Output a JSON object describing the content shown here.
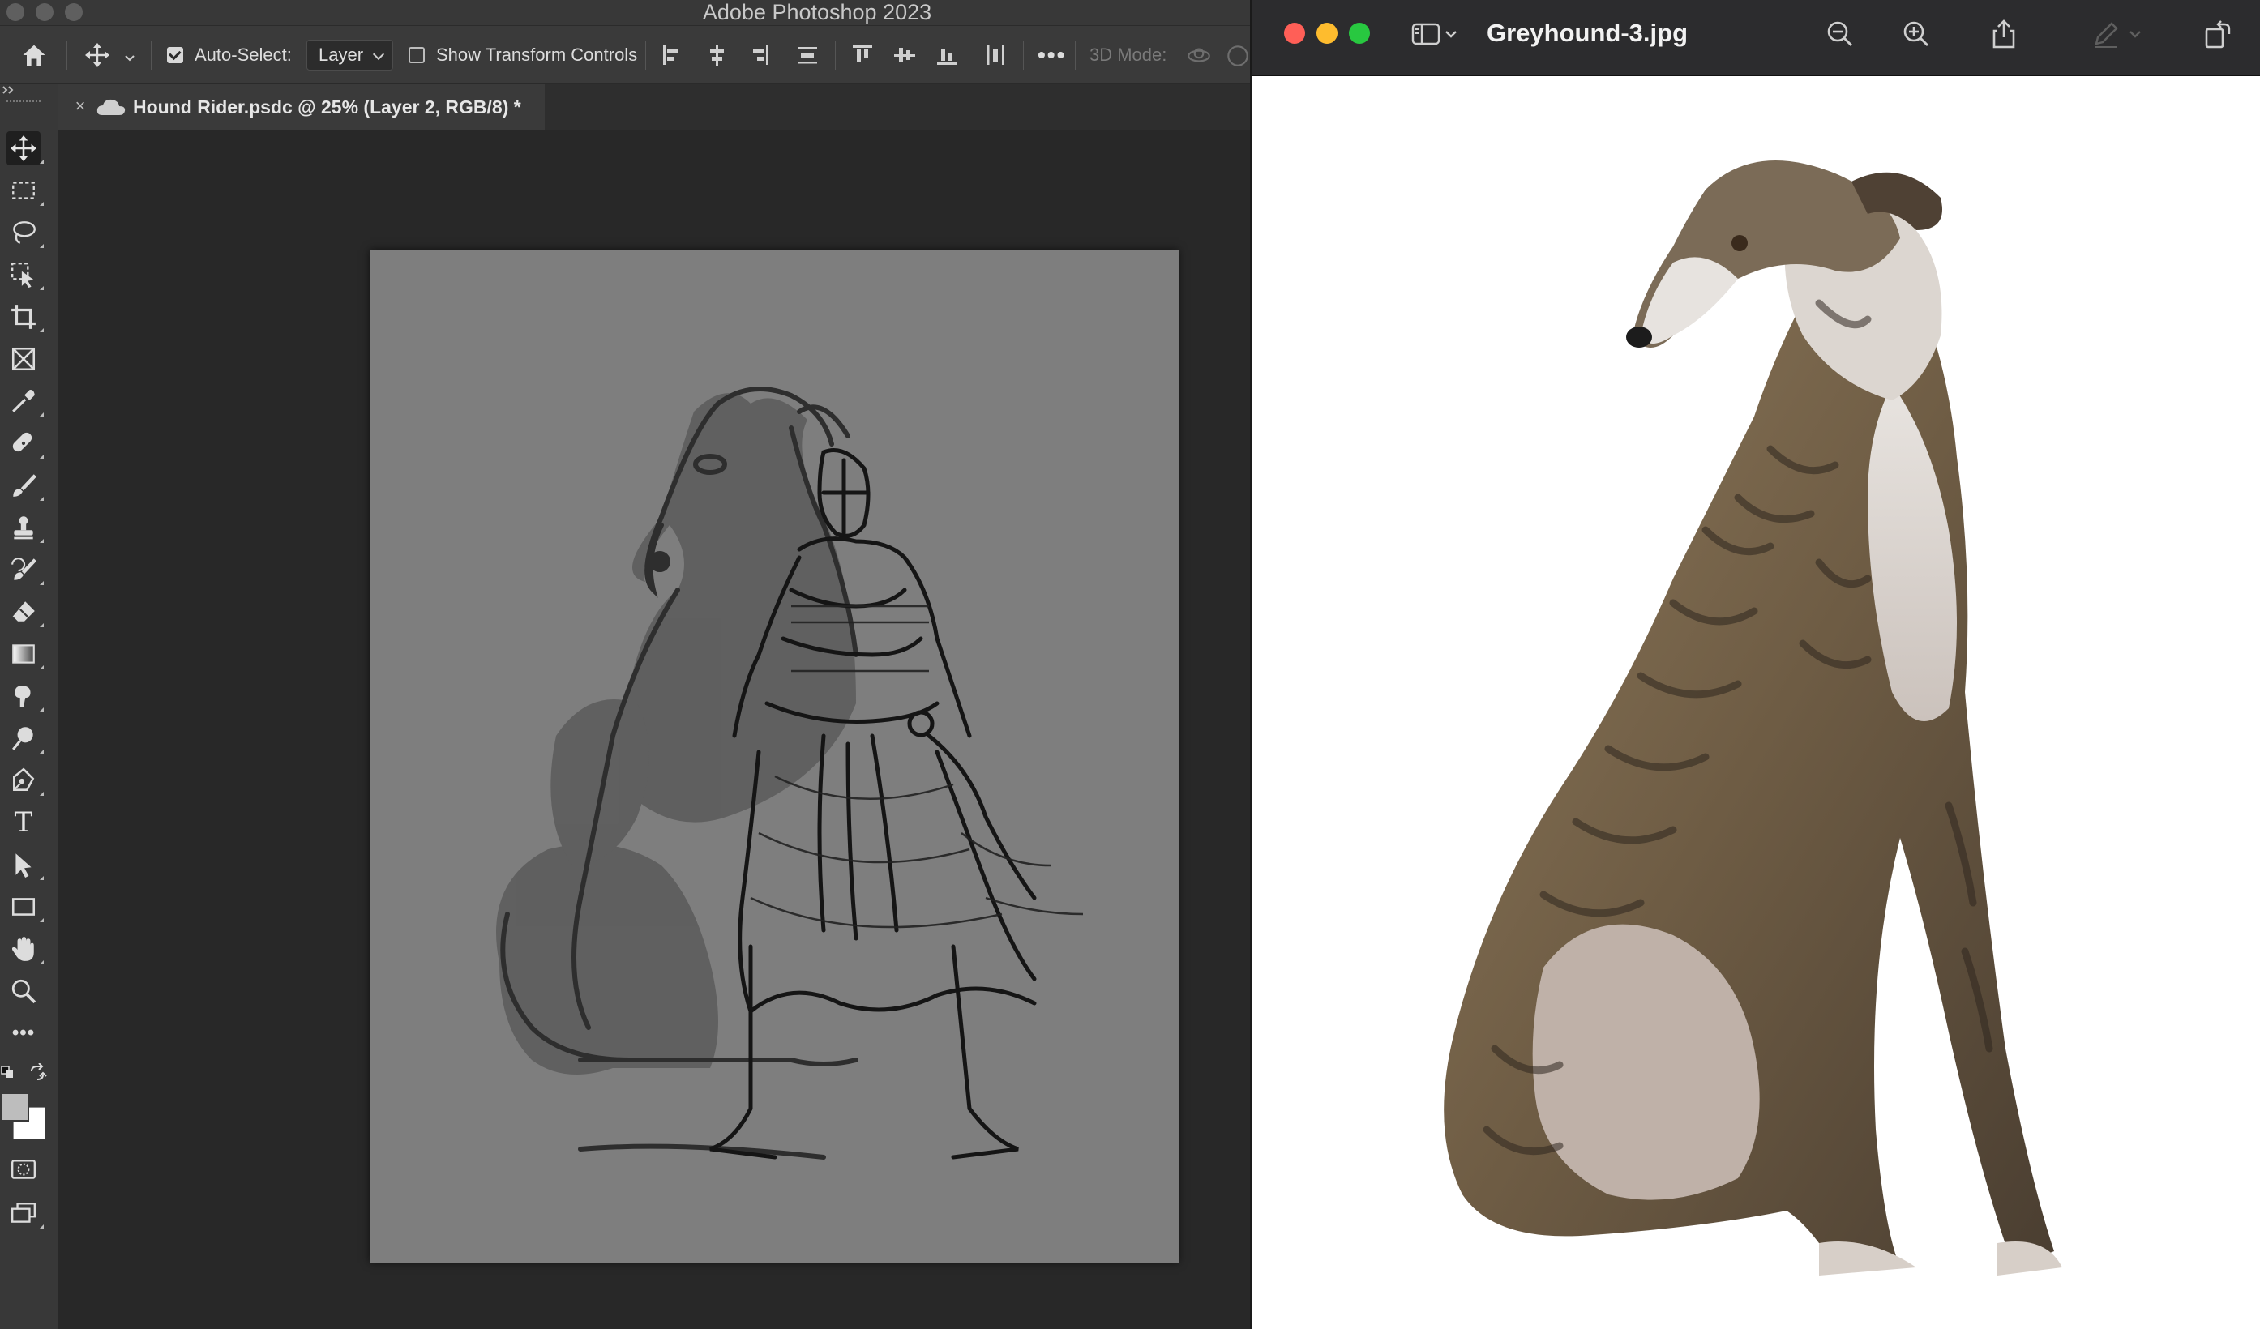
{
  "photoshop": {
    "app_title": "Adobe Photoshop 2023",
    "options_bar": {
      "auto_select_label": "Auto-Select:",
      "auto_select_checked": true,
      "auto_select_target": "Layer",
      "show_transform_label": "Show Transform Controls",
      "show_transform_checked": false,
      "more_label": "•••",
      "mode_3d_label": "3D Mode:"
    },
    "document_tab": {
      "close_glyph": "×",
      "title": "Hound Rider.psdc @ 25% (Layer 2, RGB/8) *"
    },
    "tools": [
      "move-tool-icon",
      "rectangular-marquee-icon",
      "lasso-icon",
      "object-selection-icon",
      "crop-icon",
      "frame-icon",
      "eyedropper-icon",
      "healing-brush-icon",
      "brush-icon",
      "clone-stamp-icon",
      "history-brush-icon",
      "eraser-icon",
      "gradient-icon",
      "smudge-icon",
      "dodge-icon",
      "pen-icon",
      "type-icon",
      "path-selection-icon",
      "rectangle-icon",
      "hand-icon",
      "zoom-icon",
      "more-tools-icon"
    ],
    "type_tool_glyph": "T",
    "more_tools_glyph": "•••",
    "colors": {
      "foreground": "#bdbdbd",
      "background": "#ffffff",
      "canvas": "#7e7e7e",
      "ui_dark": "#383838"
    }
  },
  "preview": {
    "window_title": "Greyhound-3.jpg",
    "colors": {
      "close": "#ff5f57",
      "minimize": "#febc2e",
      "zoom": "#28c840"
    },
    "toolbar_icons": [
      "sidebar-toggle-icon",
      "zoom-out-icon",
      "zoom-in-icon",
      "share-icon",
      "markup-pen-icon",
      "rotate-icon"
    ]
  }
}
